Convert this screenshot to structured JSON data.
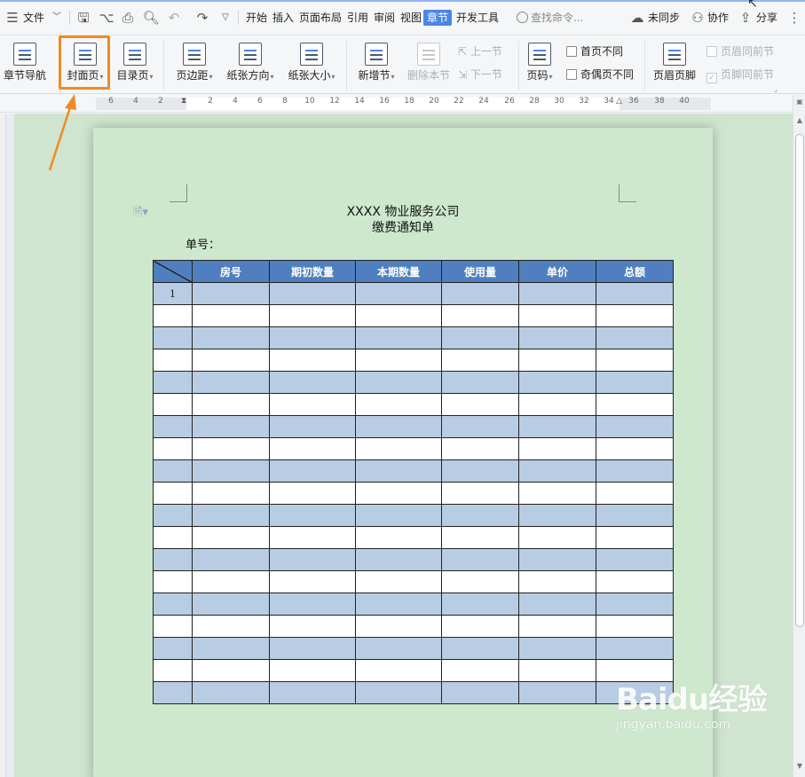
{
  "menu": {
    "file": "文件",
    "tabs": [
      "开始",
      "插入",
      "页面布局",
      "引用",
      "审阅",
      "视图",
      "章节",
      "开发工具"
    ],
    "active_tab": "章节",
    "search_placeholder": "查找命令...",
    "unsync": "未同步",
    "collab": "协作",
    "share": "分享"
  },
  "ribbon": {
    "chapter_nav": "章节导航",
    "cover": "封面页",
    "toc": "目录页",
    "margin": "页边距",
    "orientation": "纸张方向",
    "size": "纸张大小",
    "new_section": "新增节",
    "delete_section": "删除本节",
    "prev_section": "上一节",
    "next_section": "下一节",
    "page_number": "页码",
    "first_page_diff": "首页不同",
    "odd_even_diff": "奇偶页不同",
    "header_footer": "页眉页脚",
    "header_same_prev": "页眉同前节",
    "footer_same_prev": "页脚同前节"
  },
  "ruler": {
    "ticks": [
      "6",
      "4",
      "2",
      "2",
      "4",
      "6",
      "8",
      "10",
      "12",
      "14",
      "16",
      "18",
      "20",
      "22",
      "24",
      "26",
      "28",
      "30",
      "32",
      "34",
      "36",
      "38",
      "40"
    ]
  },
  "document": {
    "company": "XXXX 物业服务公司",
    "title": "缴费通知单",
    "doc_no_label": "单号：",
    "headers": [
      "房号",
      "期初数量",
      "本期数量",
      "使用量",
      "单价",
      "总额"
    ],
    "first_row_number": "1",
    "row_count": 19
  },
  "watermark": {
    "brand": "Baidu经验",
    "url": "jingyan.baidu.com"
  }
}
